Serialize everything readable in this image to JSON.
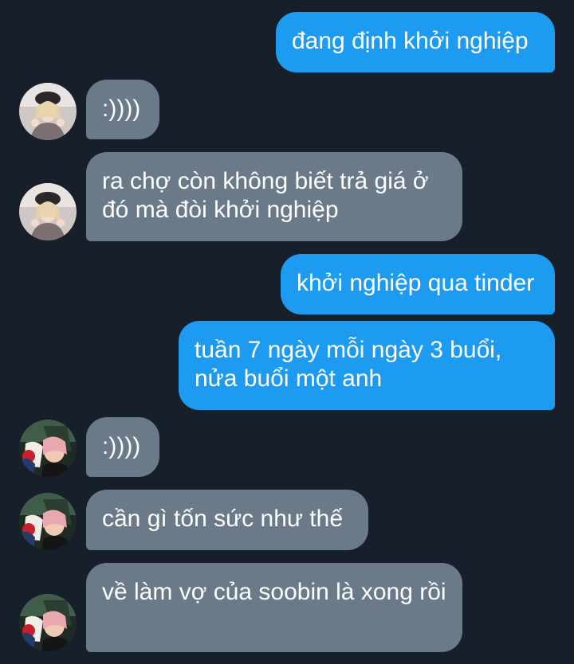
{
  "messages": [
    {
      "side": "sent",
      "text": "đang định khởi nghiệp"
    },
    {
      "side": "received",
      "text": ":))))",
      "avatar": "girl-avatar-icon"
    },
    {
      "side": "received",
      "text": "ra chợ còn không biết trả giá ở đó mà đòi khởi nghiệp",
      "avatar": "girl-avatar-icon"
    },
    {
      "side": "sent",
      "text": "khởi nghiệp qua tinder"
    },
    {
      "side": "sent",
      "text": "tuần 7 ngày mỗi ngày 3 buổi, nửa buổi một anh"
    },
    {
      "side": "received",
      "text": ":))))",
      "avatar": "anime-avatar-icon"
    },
    {
      "side": "received",
      "text": "cần gì tốn sức như thế",
      "avatar": "anime-avatar-icon"
    },
    {
      "side": "received",
      "text": "về làm vợ của soobin là xong rồi",
      "avatar": "anime-avatar-icon"
    }
  ],
  "colors": {
    "background": "#17202a",
    "sent_bubble": "#1d9bf0",
    "received_bubble": "#6b7a89",
    "text": "#ffffff"
  }
}
